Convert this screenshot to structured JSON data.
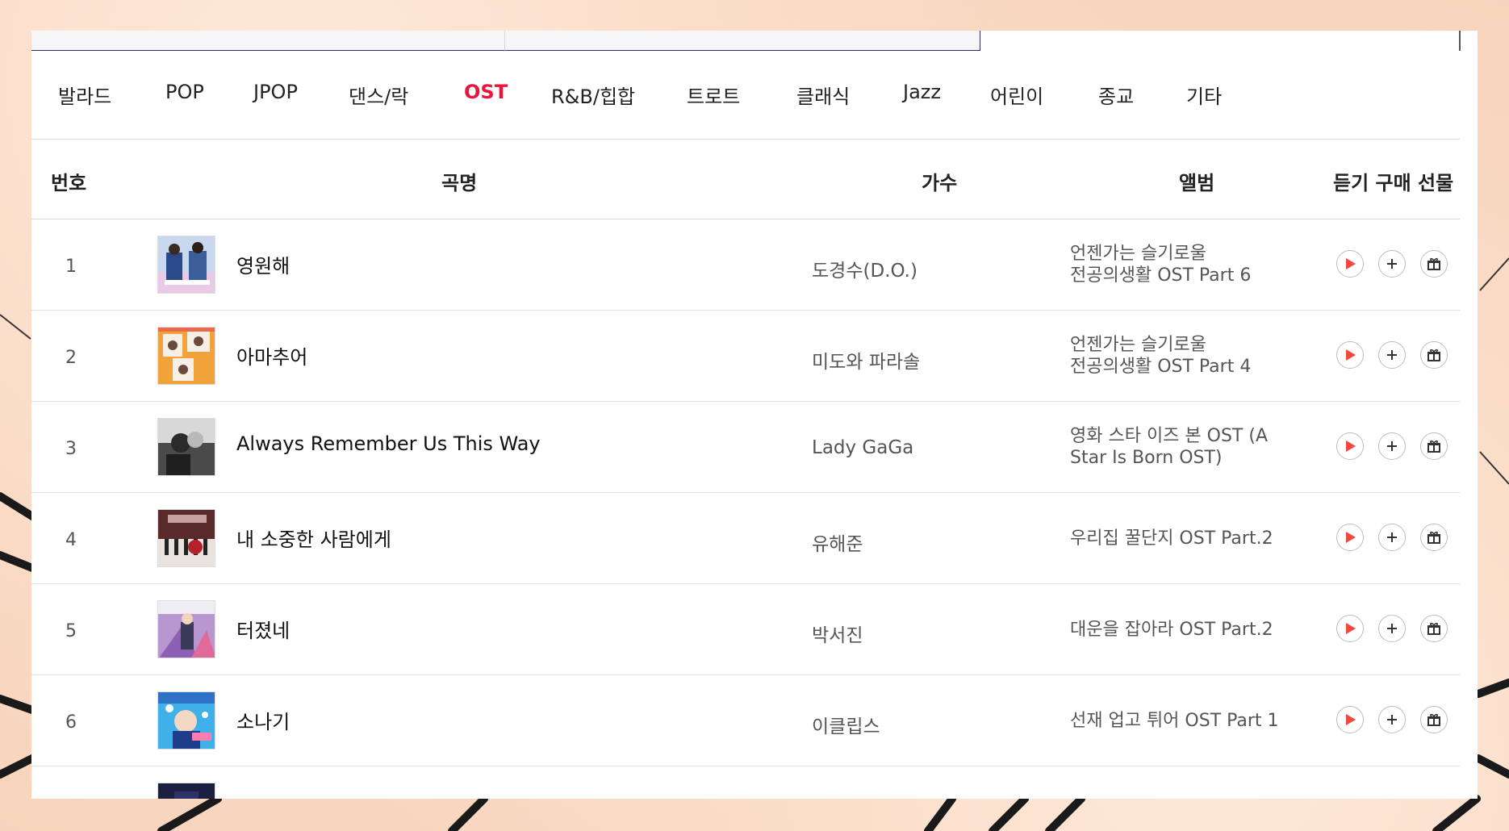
{
  "genres": [
    {
      "label": "발라드",
      "active": false
    },
    {
      "label": "POP",
      "active": false
    },
    {
      "label": "JPOP",
      "active": false
    },
    {
      "label": "댄스/락",
      "active": false
    },
    {
      "label": "OST",
      "active": true
    },
    {
      "label": "R&B/힙합",
      "active": false
    },
    {
      "label": "트로트",
      "active": false
    },
    {
      "label": "클래식",
      "active": false
    },
    {
      "label": "Jazz",
      "active": false
    },
    {
      "label": "어린이",
      "active": false
    },
    {
      "label": "종교",
      "active": false
    },
    {
      "label": "기타",
      "active": false
    }
  ],
  "table": {
    "headers": {
      "number": "번호",
      "title": "곡명",
      "artist": "가수",
      "album": "앨범",
      "actions": "듣기 구매 선물"
    },
    "rows": [
      {
        "number": "1",
        "title": "영원해",
        "artist": "도경수(D.O.)",
        "album_line1": "언젠가는 슬기로울",
        "album_line2": "전공의생활 OST Part 6"
      },
      {
        "number": "2",
        "title": "아마추어",
        "artist": "미도와 파라솔",
        "album_line1": "언젠가는 슬기로울",
        "album_line2": "전공의생활 OST Part 4"
      },
      {
        "number": "3",
        "title": "Always Remember Us This Way",
        "artist": "Lady GaGa",
        "album_line1": "영화 스타 이즈 본 OST (A",
        "album_line2": "Star Is Born OST)"
      },
      {
        "number": "4",
        "title": "내 소중한 사람에게",
        "artist": "유해준",
        "album_line1": "우리집 꿀단지 OST Part.2",
        "album_line2": ""
      },
      {
        "number": "5",
        "title": "터졌네",
        "artist": "박서진",
        "album_line1": "대운을 잡아라 OST Part.2",
        "album_line2": ""
      },
      {
        "number": "6",
        "title": "소나기",
        "artist": "이클립스",
        "album_line1": "선재 업고 튀어 OST Part 1",
        "album_line2": ""
      }
    ]
  },
  "icons": {
    "play": "play-icon",
    "add": "plus-icon",
    "gift": "gift-icon"
  },
  "colors": {
    "accent": "#e8163c",
    "play": "#f04a3f",
    "page_bg": "#f7d2b9"
  }
}
